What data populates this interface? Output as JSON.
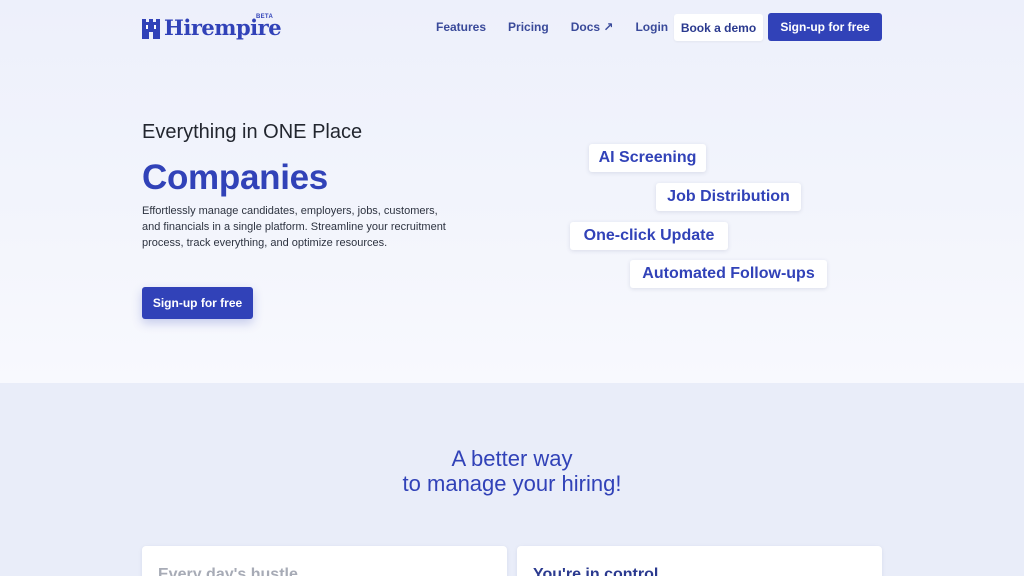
{
  "brand": {
    "name": "Hirempire",
    "badge": "BETA",
    "color": "#3142b8"
  },
  "nav": {
    "links": [
      "Features",
      "Pricing",
      "Docs ↗",
      "Login"
    ],
    "demo_button": "Book a demo",
    "signup_button": "Sign-up for free"
  },
  "hero": {
    "tagline": "Everything in ONE Place",
    "rotating_word": "Companies",
    "description": "Effortlessly manage candidates, employers, jobs, customers, and financials in a single platform. Streamline your recruitment process, track everything, and optimize resources.",
    "cta": "Sign-up for free",
    "features": [
      "AI Screening",
      "Job Distribution",
      "One-click Update",
      "Automated Follow-ups"
    ]
  },
  "section": {
    "heading_line1": "A better way",
    "heading_line2": "to manage your hiring!",
    "cards": [
      {
        "title": "Every day's hustle"
      },
      {
        "title": "You're in control"
      }
    ]
  }
}
